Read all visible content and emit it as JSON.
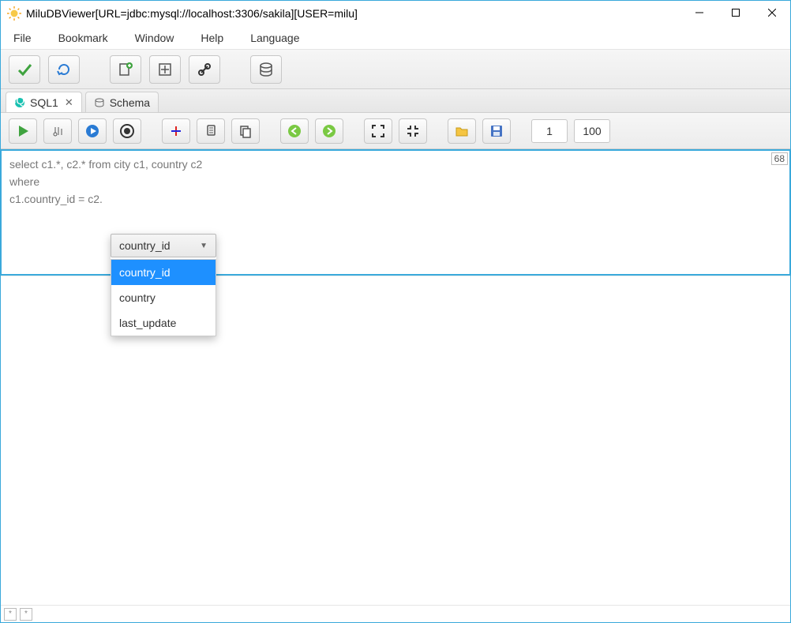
{
  "title": "MiluDBViewer[URL=jdbc:mysql://localhost:3306/sakila][USER=milu]",
  "menu": {
    "file": "File",
    "bookmark": "Bookmark",
    "window": "Window",
    "help": "Help",
    "language": "Language"
  },
  "tabs": {
    "sql": "SQL1",
    "schema": "Schema"
  },
  "inputs": {
    "from": "1",
    "to": "100"
  },
  "editor_text": "select c1.*, c2.* from city c1, country c2\nwhere\nc1.country_id = c2.",
  "line_indicator": "68",
  "autocomplete": {
    "selected": "country_id",
    "items": [
      "country_id",
      "country",
      "last_update"
    ]
  },
  "status": {
    "a": "*",
    "b": "*"
  }
}
